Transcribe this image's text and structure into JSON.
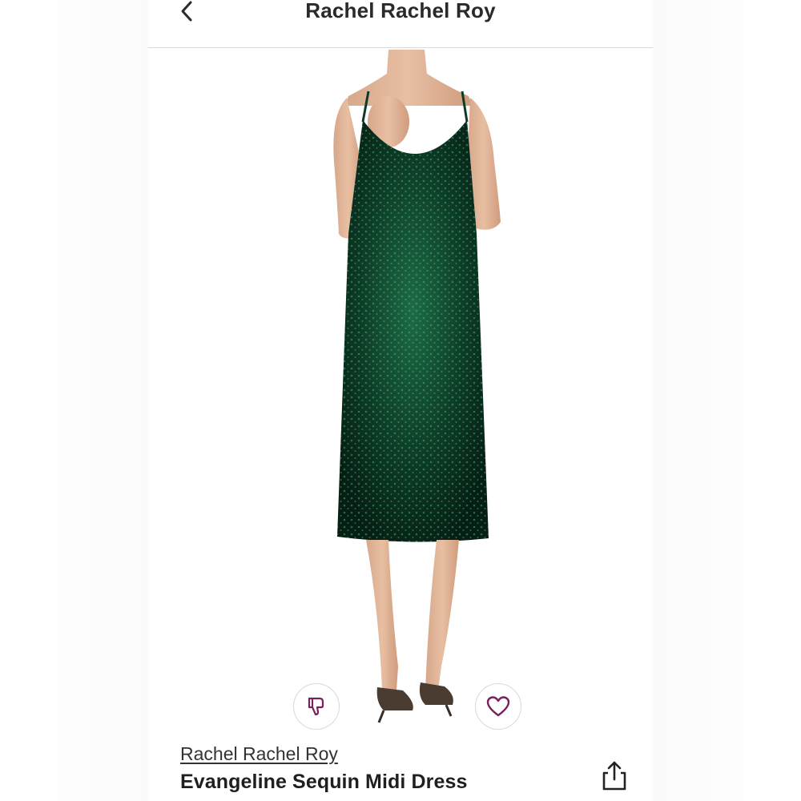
{
  "header": {
    "title": "Rachel Rachel Roy",
    "back_icon": "chevron-left-icon"
  },
  "product": {
    "brand": "Rachel Rachel Roy",
    "name": "Evangeline Sequin Midi Dress",
    "dress_color": "#0d3b26",
    "sequin_highlight": "#2fa86a"
  },
  "actions": {
    "dislike_icon": "thumbs-down-icon",
    "like_icon": "heart-icon",
    "share_icon": "share-icon",
    "accent_color": "#7a1f5c"
  }
}
